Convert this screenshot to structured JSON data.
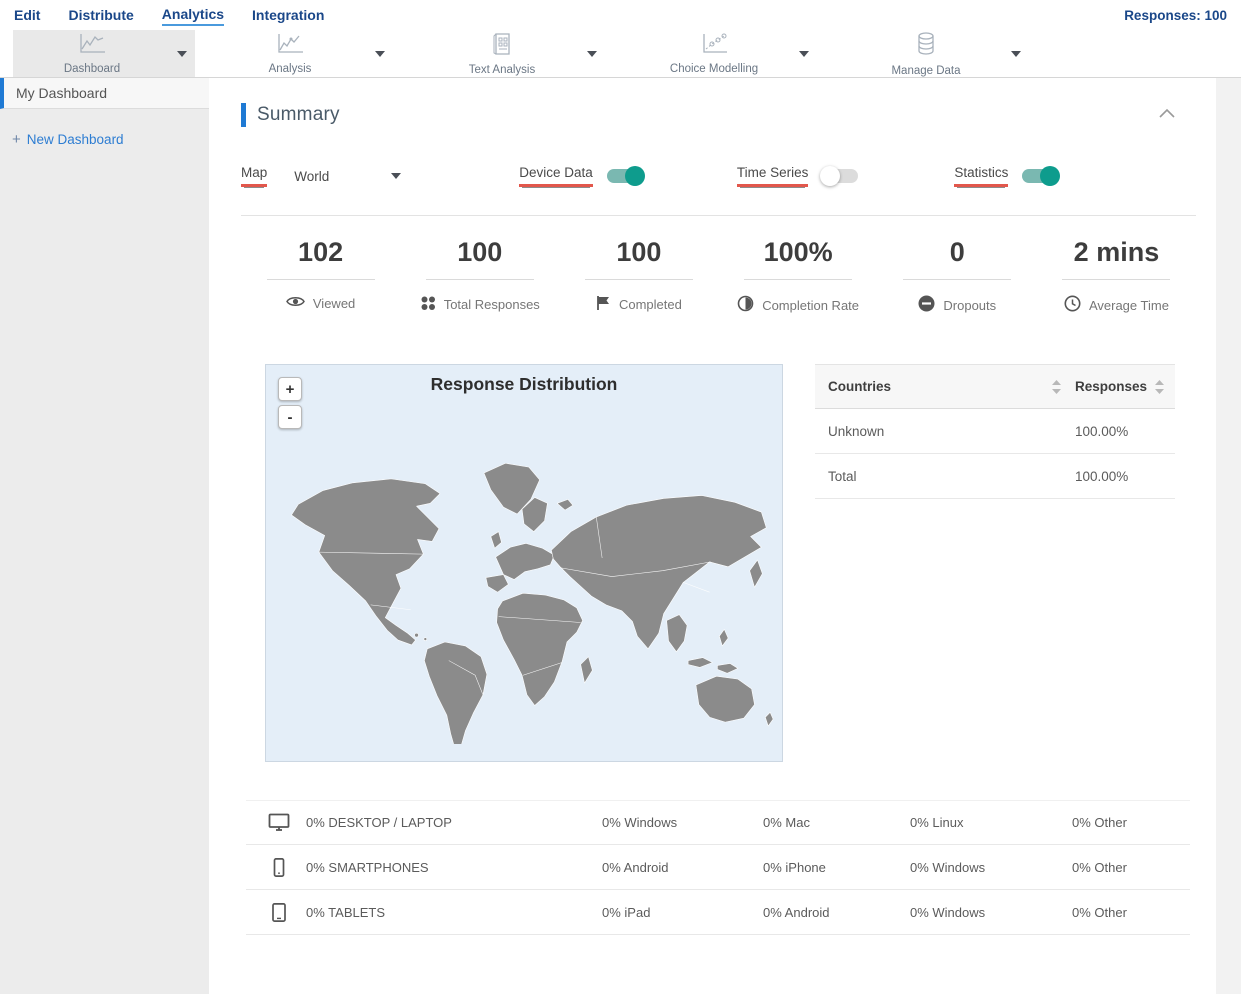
{
  "nav": {
    "items": [
      {
        "label": "Edit"
      },
      {
        "label": "Distribute"
      },
      {
        "label": "Analytics"
      },
      {
        "label": "Integration"
      }
    ],
    "responses_label": "Responses: 100"
  },
  "toolbar": {
    "items": [
      {
        "label": "Dashboard",
        "icon": "line-chart-icon",
        "active": true
      },
      {
        "label": "Analysis",
        "icon": "line-chart-icon",
        "active": false
      },
      {
        "label": "Text Analysis",
        "icon": "document-grid-icon",
        "active": false
      },
      {
        "label": "Choice Modelling",
        "icon": "scatter-chart-icon",
        "active": false
      },
      {
        "label": "Manage Data",
        "icon": "database-icon",
        "active": false
      }
    ]
  },
  "sidebar": {
    "active_item": "My Dashboard",
    "plus": "+",
    "new_dashboard_label": "New Dashboard"
  },
  "summary": {
    "title": "Summary",
    "controls": {
      "map_label": "Map",
      "map_value": "World",
      "device_data_label": "Device Data",
      "device_data_on": true,
      "time_series_label": "Time Series",
      "time_series_on": false,
      "statistics_label": "Statistics",
      "statistics_on": true
    },
    "stats": [
      {
        "value": "102",
        "label": "Viewed",
        "icon": "eye-icon"
      },
      {
        "value": "100",
        "label": "Total Responses",
        "icon": "dots-grid-icon"
      },
      {
        "value": "100",
        "label": "Completed",
        "icon": "flag-icon"
      },
      {
        "value": "100%",
        "label": "Completion Rate",
        "icon": "half-circle-icon"
      },
      {
        "value": "0",
        "label": "Dropouts",
        "icon": "minus-circle-icon"
      },
      {
        "value": "2 mins",
        "label": "Average Time",
        "icon": "clock-icon"
      }
    ],
    "map": {
      "title": "Response Distribution",
      "zoom_in": "+",
      "zoom_out": "-"
    },
    "countries_table": {
      "col1": "Countries",
      "col2": "Responses",
      "rows": [
        {
          "name": "Unknown",
          "value": "100.00%"
        },
        {
          "name": "Total",
          "value": "100.00%"
        }
      ]
    },
    "devices": [
      {
        "label": "0% DESKTOP / LAPTOP",
        "icon": "desktop-icon",
        "c1": "0% Windows",
        "c2": "0% Mac",
        "c3": "0% Linux",
        "c4": "0% Other"
      },
      {
        "label": "0% SMARTPHONES",
        "icon": "smartphone-icon",
        "c1": "0% Android",
        "c2": "0% iPhone",
        "c3": "0% Windows",
        "c4": "0% Other"
      },
      {
        "label": "0% TABLETS",
        "icon": "tablet-icon",
        "c1": "0% iPad",
        "c2": "0% Android",
        "c3": "0% Windows",
        "c4": "0% Other"
      }
    ]
  },
  "colors": {
    "nav_blue": "#1a4789",
    "active_underline_blue": "#4a9add",
    "accent_bar_blue": "#1f7ad4",
    "link_blue": "#2d7dd2",
    "label_underline_red": "#e2574c",
    "toggle_on_teal": "#0e9c8d",
    "map_ocean": "#e4eef8",
    "map_land": "#8b8b8b"
  }
}
